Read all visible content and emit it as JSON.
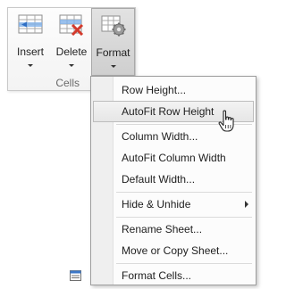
{
  "ribbon": {
    "group_label": "Cells",
    "buttons": [
      {
        "label": "Insert",
        "icon": "insert-rows-icon"
      },
      {
        "label": "Delete",
        "icon": "delete-rows-icon"
      },
      {
        "label": "Format",
        "icon": "format-gear-icon",
        "state": "pressed"
      }
    ]
  },
  "menu": {
    "items": [
      {
        "label": "Row Height..."
      },
      {
        "label": "AutoFit Row Height",
        "state": "hover"
      },
      {
        "label": "Column Width..."
      },
      {
        "label": "AutoFit Column Width"
      },
      {
        "label": "Default Width..."
      },
      {
        "label": "Hide & Unhide",
        "has_submenu": true
      },
      {
        "label": "Rename Sheet..."
      },
      {
        "label": "Move or Copy Sheet..."
      },
      {
        "label": "Format Cells...",
        "icon": "format-cells-icon"
      }
    ]
  },
  "colors": {
    "accent_blue": "#2f6fc4",
    "delete_red": "#d33a2c",
    "hover_border": "#bdbdbd"
  }
}
